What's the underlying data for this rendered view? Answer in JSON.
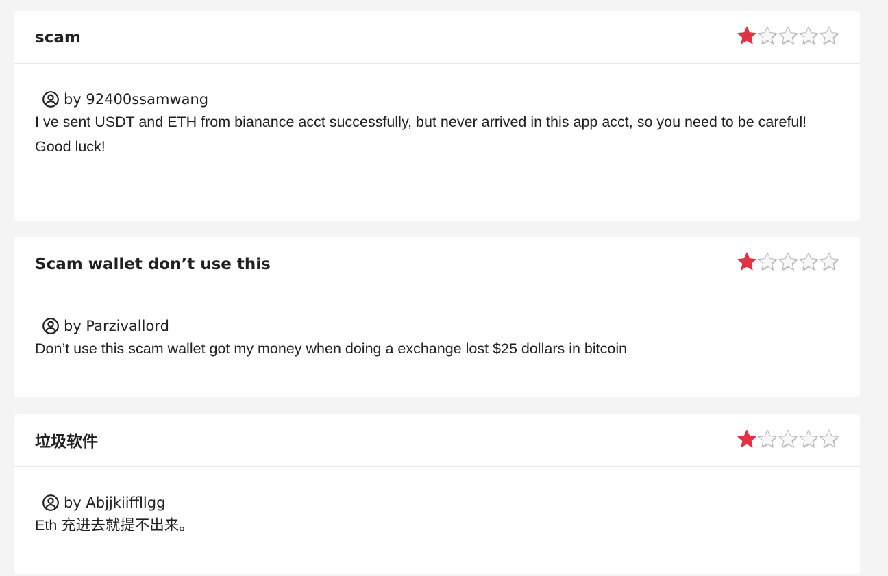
{
  "reviews": [
    {
      "title": "scam",
      "rating": 1,
      "max_rating": 5,
      "author": "by 92400ssamwang",
      "lines": [
        "I ve sent USDT and ETH from bianance acct successfully, but never arrived in this app acct, so you need to be careful!",
        "Good luck!"
      ]
    },
    {
      "title": "Scam wallet don’t use this",
      "rating": 1,
      "max_rating": 5,
      "author": "by Parzivallord",
      "lines": [
        "Don’t use this scam wallet got my money when doing a exchange lost $25 dollars in bitcoin"
      ]
    },
    {
      "title": "垃圾软件",
      "rating": 1,
      "max_rating": 5,
      "author": "by Abjjkiiffllgg",
      "lines": [
        "Eth 充进去就提不出来。"
      ]
    }
  ],
  "colors": {
    "star_filled": "#e03345",
    "star_empty": "#f7f7f9",
    "page_background": "#f4f4f4",
    "card_background": "#ffffff"
  },
  "icons": {
    "star": "star-icon",
    "author": "user-circle-icon"
  }
}
